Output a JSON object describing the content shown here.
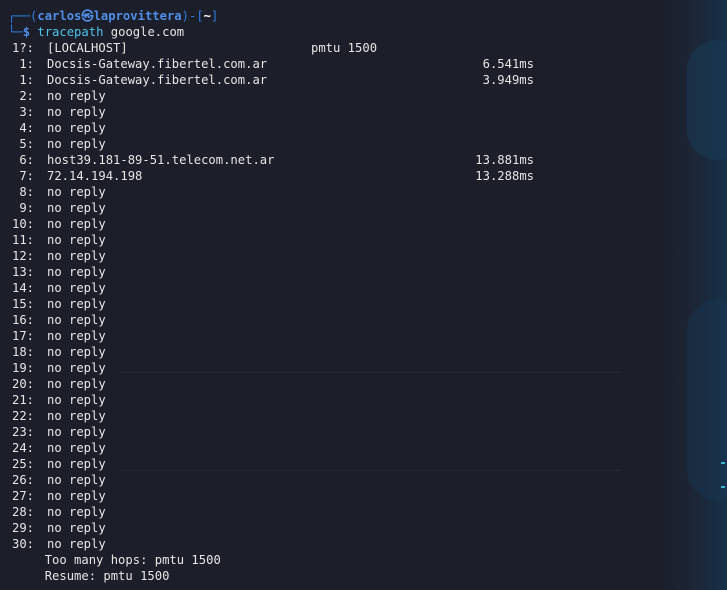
{
  "prompt": {
    "user": "carlos",
    "host": "laprovittera",
    "dir": "~",
    "command": "tracepath",
    "argument": "google.com"
  },
  "hops": [
    {
      "num": "1?:",
      "host": "[LOCALHOST]",
      "extra": "pmtu 1500",
      "time": ""
    },
    {
      "num": "1:",
      "host": "Docsis-Gateway.fibertel.com.ar",
      "extra": "",
      "time": "6.541ms"
    },
    {
      "num": "1:",
      "host": "Docsis-Gateway.fibertel.com.ar",
      "extra": "",
      "time": "3.949ms"
    },
    {
      "num": "2:",
      "host": "no reply",
      "extra": "",
      "time": ""
    },
    {
      "num": "3:",
      "host": "no reply",
      "extra": "",
      "time": ""
    },
    {
      "num": "4:",
      "host": "no reply",
      "extra": "",
      "time": ""
    },
    {
      "num": "5:",
      "host": "no reply",
      "extra": "",
      "time": ""
    },
    {
      "num": "6:",
      "host": "host39.181-89-51.telecom.net.ar",
      "extra": "",
      "time": "13.881ms"
    },
    {
      "num": "7:",
      "host": "72.14.194.198",
      "extra": "",
      "time": "13.288ms"
    },
    {
      "num": "8:",
      "host": "no reply",
      "extra": "",
      "time": ""
    },
    {
      "num": "9:",
      "host": "no reply",
      "extra": "",
      "time": ""
    },
    {
      "num": "10:",
      "host": "no reply",
      "extra": "",
      "time": ""
    },
    {
      "num": "11:",
      "host": "no reply",
      "extra": "",
      "time": ""
    },
    {
      "num": "12:",
      "host": "no reply",
      "extra": "",
      "time": ""
    },
    {
      "num": "13:",
      "host": "no reply",
      "extra": "",
      "time": ""
    },
    {
      "num": "14:",
      "host": "no reply",
      "extra": "",
      "time": ""
    },
    {
      "num": "15:",
      "host": "no reply",
      "extra": "",
      "time": ""
    },
    {
      "num": "16:",
      "host": "no reply",
      "extra": "",
      "time": ""
    },
    {
      "num": "17:",
      "host": "no reply",
      "extra": "",
      "time": ""
    },
    {
      "num": "18:",
      "host": "no reply",
      "extra": "",
      "time": ""
    },
    {
      "num": "19:",
      "host": "no reply",
      "extra": "",
      "time": ""
    },
    {
      "num": "20:",
      "host": "no reply",
      "extra": "",
      "time": ""
    },
    {
      "num": "21:",
      "host": "no reply",
      "extra": "",
      "time": ""
    },
    {
      "num": "22:",
      "host": "no reply",
      "extra": "",
      "time": ""
    },
    {
      "num": "23:",
      "host": "no reply",
      "extra": "",
      "time": ""
    },
    {
      "num": "24:",
      "host": "no reply",
      "extra": "",
      "time": ""
    },
    {
      "num": "25:",
      "host": "no reply",
      "extra": "",
      "time": ""
    },
    {
      "num": "26:",
      "host": "no reply",
      "extra": "",
      "time": ""
    },
    {
      "num": "27:",
      "host": "no reply",
      "extra": "",
      "time": ""
    },
    {
      "num": "28:",
      "host": "no reply",
      "extra": "",
      "time": ""
    },
    {
      "num": "29:",
      "host": "no reply",
      "extra": "",
      "time": ""
    },
    {
      "num": "30:",
      "host": "no reply",
      "extra": "",
      "time": ""
    }
  ],
  "summary": {
    "too_many": "Too many hops: pmtu 1500",
    "resume": "Resume: pmtu 1500"
  },
  "colors": {
    "background": "#1c1e29",
    "prompt_accent": "#4f8fe8",
    "command": "#4fc2e8",
    "text": "#e6e6e6"
  }
}
